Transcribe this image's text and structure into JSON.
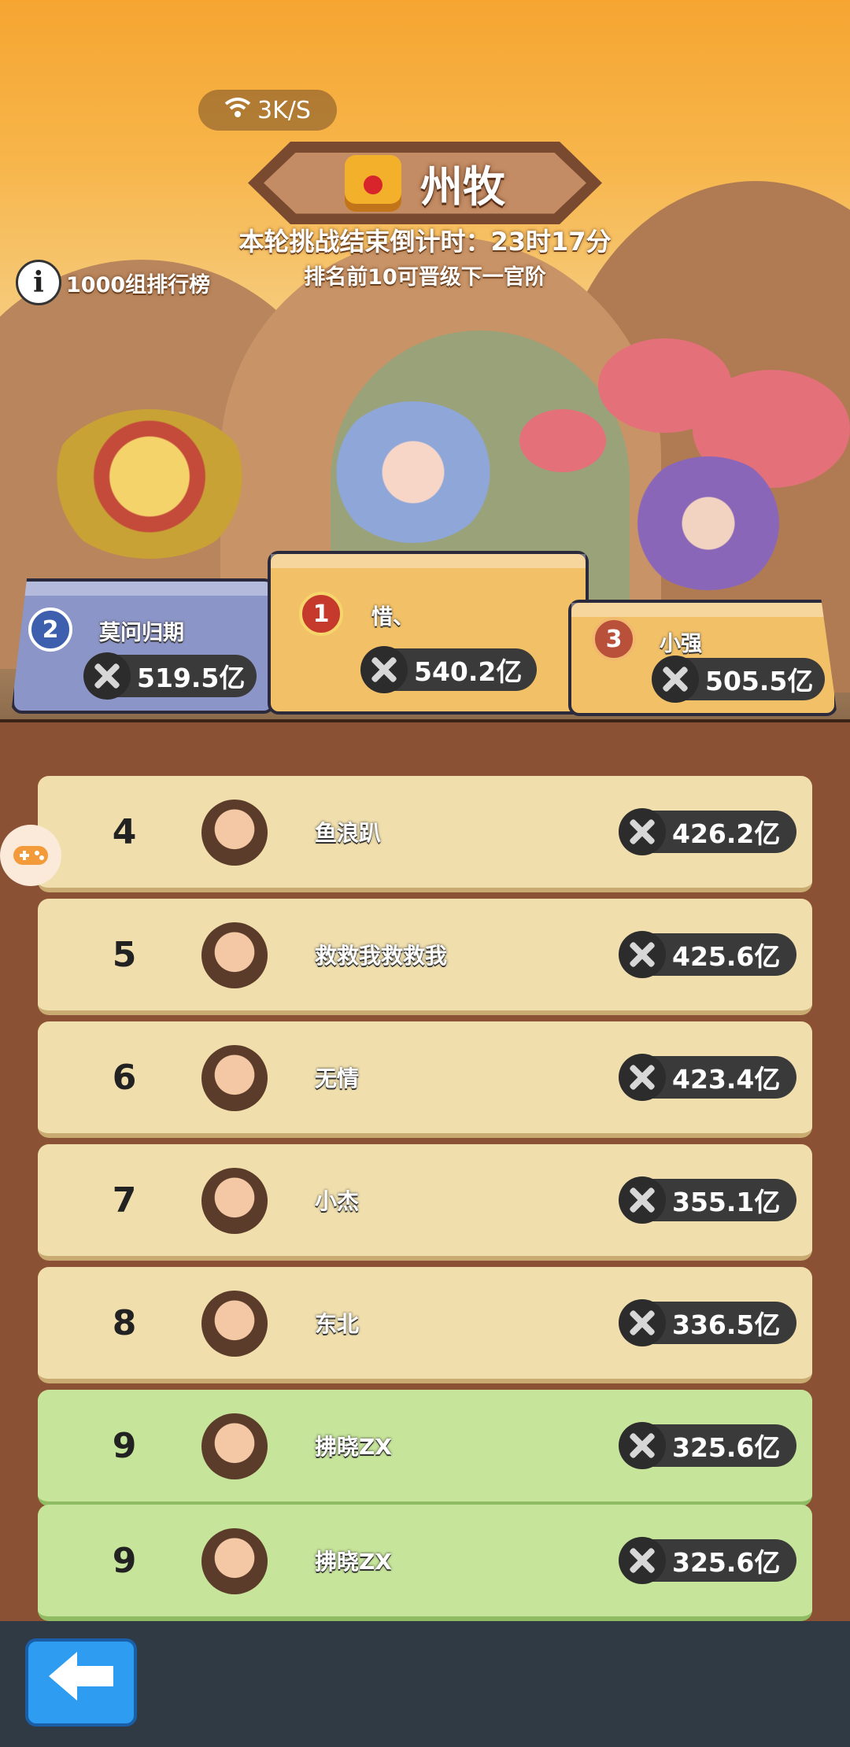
{
  "status": {
    "network_speed": "3K/S"
  },
  "header": {
    "title": "州牧",
    "countdown": "本轮挑战结束倒计时：23时17分",
    "hint": "排名前10可晋级下一官阶",
    "group_label": "1000组排行榜"
  },
  "podium": [
    {
      "rank": "2",
      "name": "莫问归期",
      "power": "519.5亿"
    },
    {
      "rank": "1",
      "name": "惜、",
      "power": "540.2亿"
    },
    {
      "rank": "3",
      "name": "小强",
      "power": "505.5亿"
    }
  ],
  "leaderboard": [
    {
      "rank": "4",
      "name": "鱼浪趴",
      "power": "426.2亿",
      "highlight": false
    },
    {
      "rank": "5",
      "name": "救救我救救我",
      "power": "425.6亿",
      "highlight": false
    },
    {
      "rank": "6",
      "name": "无情",
      "power": "423.4亿",
      "highlight": false
    },
    {
      "rank": "7",
      "name": "小杰",
      "power": "355.1亿",
      "highlight": false
    },
    {
      "rank": "8",
      "name": "东北",
      "power": "336.5亿",
      "highlight": false
    },
    {
      "rank": "9",
      "name": "拂晓ZX",
      "power": "325.6亿",
      "highlight": true
    },
    {
      "rank": "9",
      "name": "拂晓ZX",
      "power": "325.6亿",
      "highlight": true
    }
  ],
  "icons": {
    "back": "arrow-left-icon",
    "info": "info-icon",
    "power": "crossed-swords-icon",
    "wifi": "wifi-icon",
    "game": "gamepad-icon"
  },
  "colors": {
    "row_default": "#f0dfad",
    "row_highlight": "#c6e49a",
    "panel": "#8a5134",
    "back_button": "#2e9cf0"
  }
}
